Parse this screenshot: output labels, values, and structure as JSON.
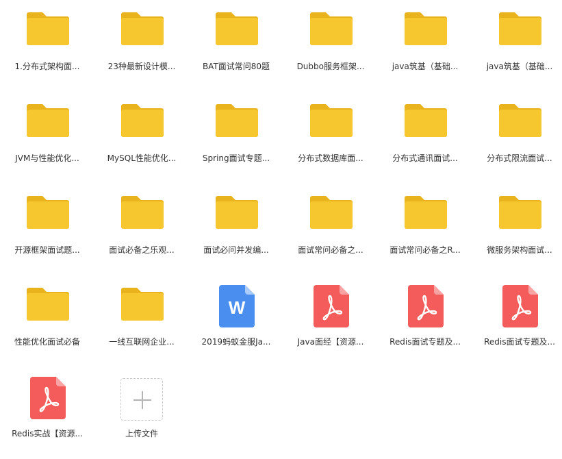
{
  "files": [
    {
      "name": "1.分布式架构面...",
      "type": "folder"
    },
    {
      "name": "23种最新设计模...",
      "type": "folder"
    },
    {
      "name": "BAT面试常问80题",
      "type": "folder"
    },
    {
      "name": "Dubbo服务框架...",
      "type": "folder"
    },
    {
      "name": "java筑基（基础...",
      "type": "folder"
    },
    {
      "name": "java筑基（基础...",
      "type": "folder"
    },
    {
      "name": "JVM与性能优化...",
      "type": "folder"
    },
    {
      "name": "MySQL性能优化...",
      "type": "folder"
    },
    {
      "name": "Spring面试专题...",
      "type": "folder"
    },
    {
      "name": "分布式数据库面...",
      "type": "folder"
    },
    {
      "name": "分布式通讯面试...",
      "type": "folder"
    },
    {
      "name": "分布式限流面试...",
      "type": "folder"
    },
    {
      "name": "开源框架面试题...",
      "type": "folder"
    },
    {
      "name": "面试必备之乐观...",
      "type": "folder"
    },
    {
      "name": "面试必问并发编...",
      "type": "folder"
    },
    {
      "name": "面试常问必备之...",
      "type": "folder"
    },
    {
      "name": "面试常问必备之R...",
      "type": "folder"
    },
    {
      "name": "微服务架构面试...",
      "type": "folder"
    },
    {
      "name": "性能优化面试必备",
      "type": "folder"
    },
    {
      "name": "一线互联网企业...",
      "type": "folder"
    },
    {
      "name": "2019蚂蚁金服Ja...",
      "type": "word"
    },
    {
      "name": "Java面经【资源...",
      "type": "pdf"
    },
    {
      "name": "Redis面试专题及...",
      "type": "pdf"
    },
    {
      "name": "Redis面试专题及...",
      "type": "pdf"
    },
    {
      "name": "Redis实战【资源...",
      "type": "pdf"
    }
  ],
  "upload": {
    "label": "上传文件",
    "icon": "plus-icon"
  },
  "colors": {
    "folder": "#F7C730",
    "folder_tab": "#E9B31E",
    "word": "#4A8FF0",
    "word_fold": "#A9CBFA",
    "pdf": "#F45B5B",
    "pdf_fold": "#F9A3A3",
    "text": "#333333"
  }
}
